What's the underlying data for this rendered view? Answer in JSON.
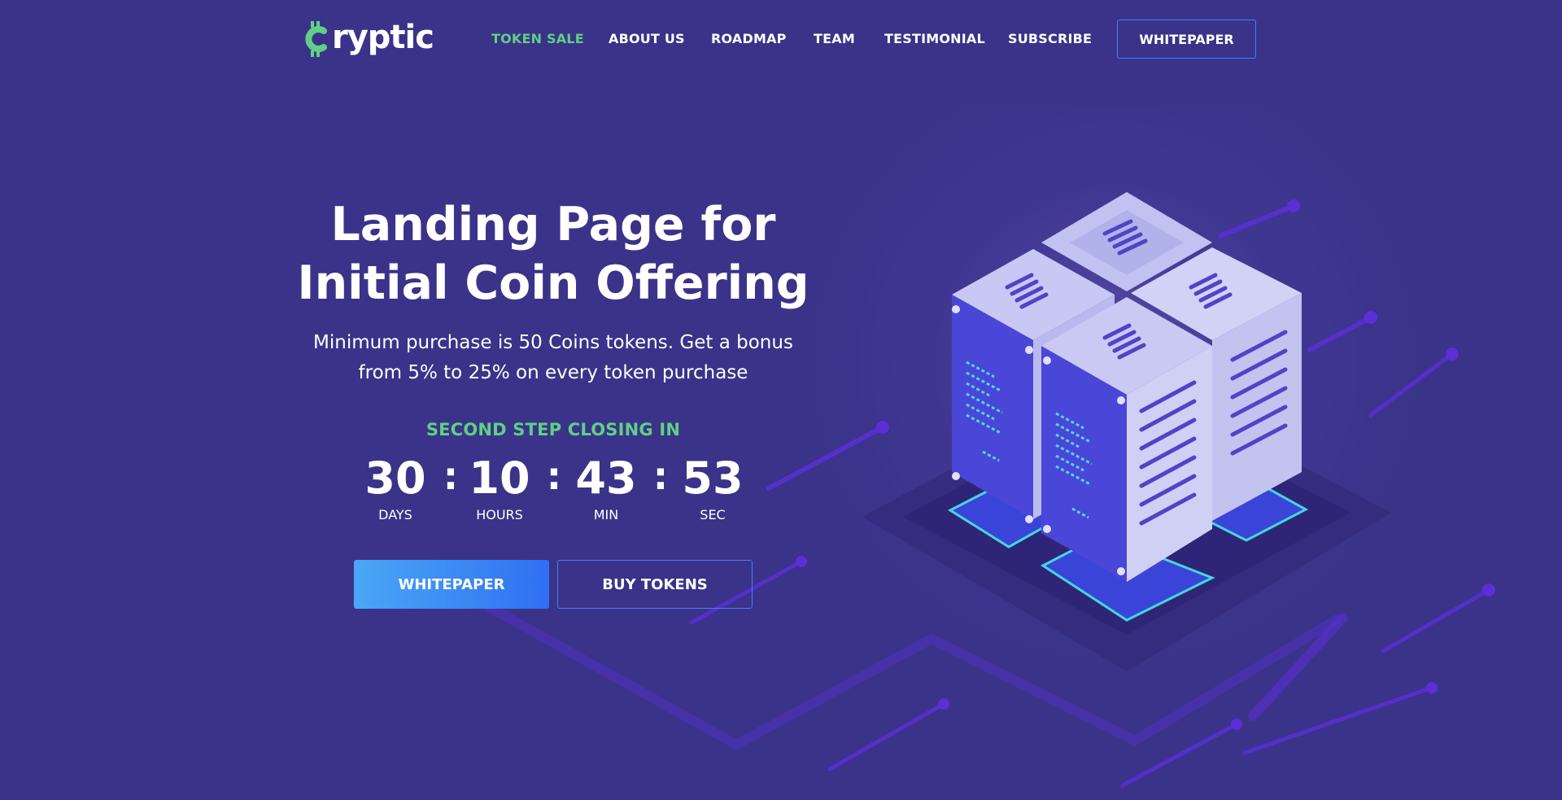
{
  "brand": {
    "logo_text": "ryptic",
    "logo_icon": "bitcoin-c-icon",
    "accent_color": "#5fd085",
    "background_color": "#3a3389",
    "button_blue": "#2f6ff2"
  },
  "nav": {
    "items": [
      {
        "label": "TOKEN SALE",
        "active": true
      },
      {
        "label": "ABOUT US",
        "active": false
      },
      {
        "label": "ROADMAP",
        "active": false
      },
      {
        "label": "TEAM",
        "active": false
      },
      {
        "label": "TESTIMONIAL",
        "active": false
      },
      {
        "label": "SUBSCRIBE",
        "active": false
      }
    ],
    "cta_label": "WHITEPAPER"
  },
  "hero": {
    "title_line1": "Landing Page for",
    "title_line2": "Initial Coin Offering",
    "subtitle_line1": "Minimum purchase is 50 Coins tokens. Get a bonus",
    "subtitle_line2": "from 5% to 25% on every token purchase",
    "closing_label": "SECOND STEP CLOSING IN",
    "countdown": [
      {
        "value": "30",
        "unit": "DAYS"
      },
      {
        "value": "10",
        "unit": "HOURS"
      },
      {
        "value": "43",
        "unit": "MIN"
      },
      {
        "value": "53",
        "unit": "SEC"
      }
    ],
    "separator": ":",
    "primary_button": "WHITEPAPER",
    "secondary_button": "BUY TOKENS",
    "illustration": "isometric-server-racks-illustration"
  }
}
